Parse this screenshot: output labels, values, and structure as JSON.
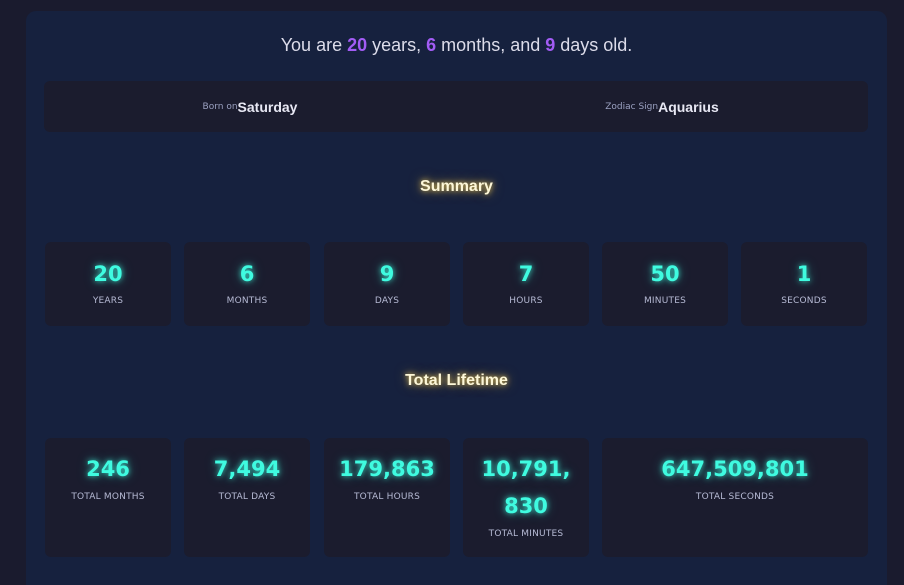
{
  "headline": {
    "prefix": "You are ",
    "years": "20",
    "years_word": " years, ",
    "months": "6",
    "months_word": " months, and ",
    "days": "9",
    "days_word": " days old."
  },
  "info": {
    "born_label": "Born on",
    "born_value": "Saturday",
    "zodiac_label": "Zodiac Sign",
    "zodiac_value": "Aquarius"
  },
  "summary": {
    "title": "Summary",
    "items": [
      {
        "value": "20",
        "label": "YEARS"
      },
      {
        "value": "6",
        "label": "MONTHS"
      },
      {
        "value": "9",
        "label": "DAYS"
      },
      {
        "value": "7",
        "label": "HOURS"
      },
      {
        "value": "50",
        "label": "MINUTES"
      },
      {
        "value": "1",
        "label": "SECONDS"
      }
    ]
  },
  "lifetime": {
    "title": "Total Lifetime",
    "items": [
      {
        "value": "246",
        "label": "TOTAL MONTHS"
      },
      {
        "value": "7,494",
        "label": "TOTAL DAYS"
      },
      {
        "value": "179,863",
        "label": "TOTAL HOURS"
      },
      {
        "value": "10,791,830",
        "label": "TOTAL MINUTES"
      },
      {
        "value": "647,509,801",
        "label": "TOTAL SECONDS"
      }
    ]
  },
  "colors": {
    "page_bg": "#1a1b2e",
    "panel_bg": "#16213e",
    "card_bg": "#1b1c2e",
    "accent_purple": "#a25cf5",
    "accent_cyan": "#3ffbe0",
    "title_glow": "#ffd75a"
  }
}
